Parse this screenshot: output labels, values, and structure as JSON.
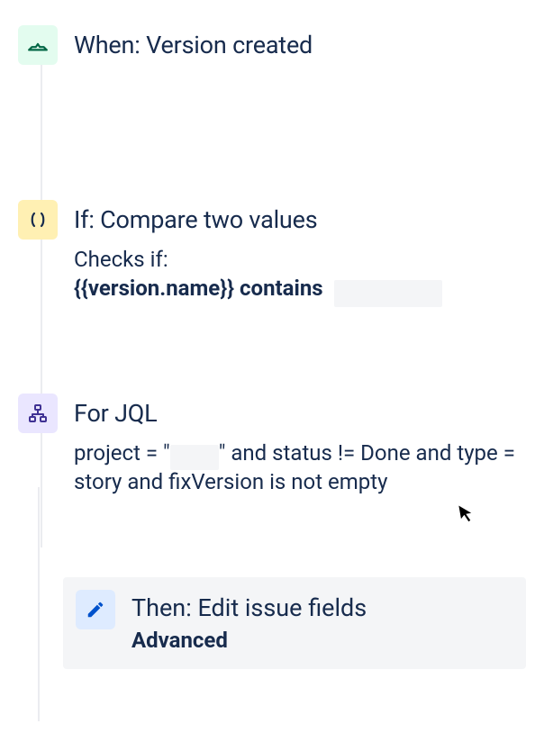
{
  "trigger": {
    "title": "When: Version created"
  },
  "condition": {
    "title": "If: Compare two values",
    "checks_label": "Checks if:",
    "expression_left": "{{version.name}}",
    "expression_op": "contains"
  },
  "branch": {
    "title": "For JQL",
    "jql_prefix": "project = \"",
    "jql_suffix": "\" and status != Done and type = story and fixVersion is not empty"
  },
  "action": {
    "title": "Then: Edit issue fields",
    "subtitle": "Advanced"
  }
}
